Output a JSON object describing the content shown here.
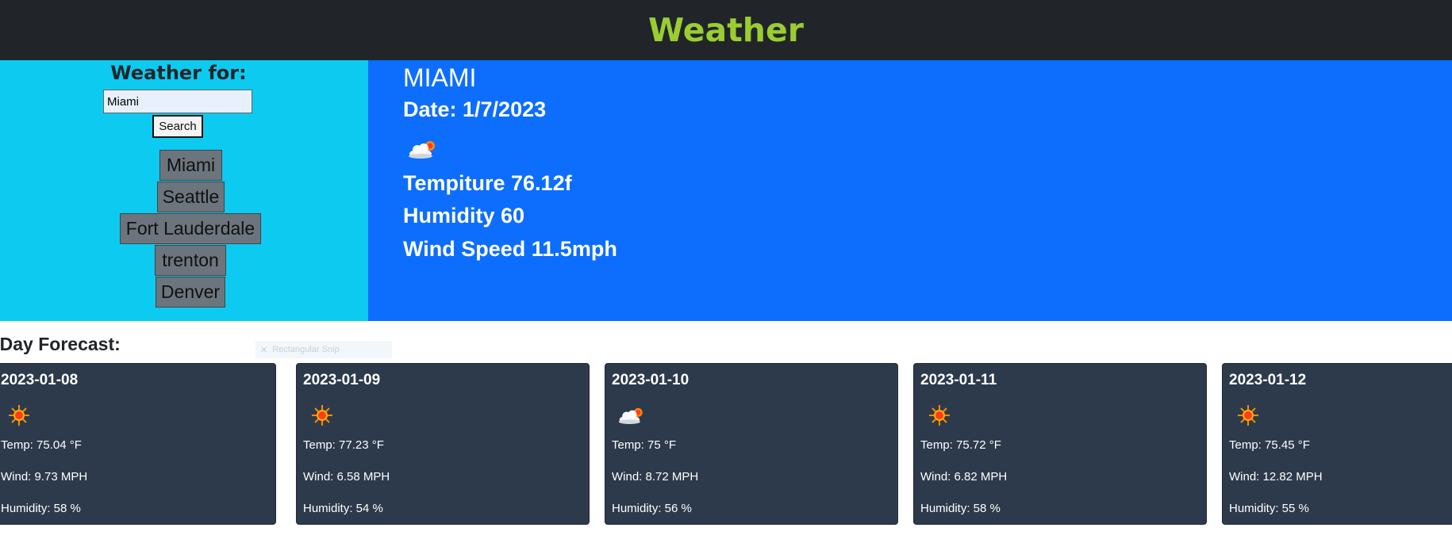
{
  "header": {
    "title": "Weather"
  },
  "sidebar": {
    "label": "Weather for:",
    "search_value": "Miami",
    "search_button": "Search",
    "history": [
      "Miami",
      "Seattle",
      "Fort Lauderdale",
      "trenton",
      "Denver"
    ]
  },
  "current": {
    "city": "MIAMI",
    "date": "Date: 1/7/2023",
    "icon": "partly-cloudy-icon",
    "temperature": "Tempiture 76.12f",
    "humidity": "Humidity 60",
    "wind": "Wind Speed 11.5mph"
  },
  "forecast": {
    "title": "-Day Forecast:",
    "snip_text": "Rectangular Snip",
    "days": [
      {
        "date": "2023-01-08",
        "icon": "sun-icon",
        "temp": "Temp: 75.04 °F",
        "wind": "Wind: 9.73 MPH",
        "humidity": "Humidity: 58 %"
      },
      {
        "date": "2023-01-09",
        "icon": "sun-icon",
        "temp": "Temp: 77.23 °F",
        "wind": "Wind: 6.58 MPH",
        "humidity": "Humidity: 54 %"
      },
      {
        "date": "2023-01-10",
        "icon": "partly-cloudy-icon",
        "temp": "Temp: 75 °F",
        "wind": "Wind: 8.72 MPH",
        "humidity": "Humidity: 56 %"
      },
      {
        "date": "2023-01-11",
        "icon": "sun-icon",
        "temp": "Temp: 75.72 °F",
        "wind": "Wind: 6.82 MPH",
        "humidity": "Humidity: 58 %"
      },
      {
        "date": "2023-01-12",
        "icon": "sun-icon",
        "temp": "Temp: 75.45 °F",
        "wind": "Wind: 12.82 MPH",
        "humidity": "Humidity: 55 %"
      }
    ]
  },
  "colors": {
    "header_bg": "#212529",
    "title": "#9acd32",
    "sidebar_bg": "#0dcaf0",
    "main_bg": "#0d6efd",
    "history_btn_bg": "#6c757d",
    "card_bg": "#2c3a4c"
  }
}
